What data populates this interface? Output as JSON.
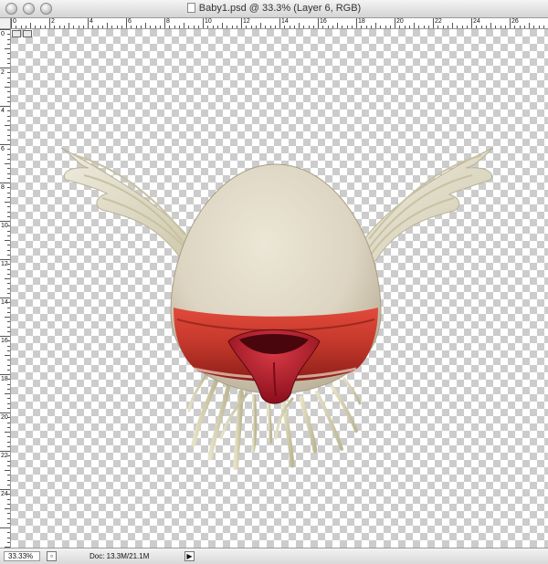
{
  "window": {
    "title": "Baby1.psd @ 33.3% (Layer 6, RGB)"
  },
  "ruler": {
    "top_labels": [
      "0",
      "2",
      "4",
      "6",
      "8",
      "10",
      "12",
      "14",
      "16",
      "18",
      "20",
      "22",
      "24",
      "26"
    ],
    "left_labels": [
      "0",
      "2",
      "4",
      "6",
      "8",
      "10",
      "12",
      "14",
      "16",
      "18",
      "20",
      "22",
      "24"
    ]
  },
  "status": {
    "zoom": "33.33%",
    "doc": "Doc: 13.3M/21.1M",
    "menu_arrow": "▶",
    "info_icon": "page-icon"
  },
  "colors": {
    "egg": "#ddd5c2",
    "wing": "#e4e0cc",
    "lip_red": "#c2372b",
    "tongue": "#b21f2a",
    "checker": "#cccccc"
  }
}
